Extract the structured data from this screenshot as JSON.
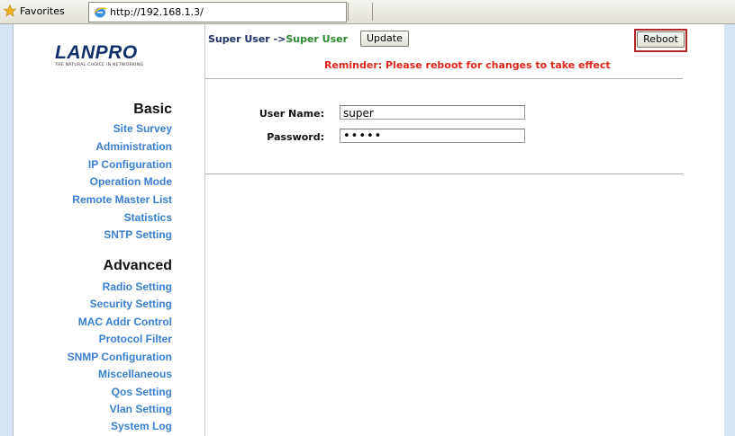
{
  "browser": {
    "favorites_label": "Favorites",
    "address": "http://192.168.1.3/"
  },
  "logo": {
    "name": "LANPRO",
    "tagline": "THE NATURAL CHOICE IN NETWORKING"
  },
  "sidebar": {
    "basic_heading": "Basic",
    "basic_items": [
      "Site Survey",
      "Administration",
      "IP Configuration",
      "Operation Mode",
      "Remote Master List",
      "Statistics",
      "SNTP Setting"
    ],
    "advanced_heading": "Advanced",
    "advanced_items": [
      "Radio Setting",
      "Security Setting",
      "MAC Addr Control",
      "Protocol Filter",
      "SNMP Configuration",
      "Miscellaneous",
      "Qos Setting",
      "Vlan Setting",
      "System Log"
    ]
  },
  "header": {
    "crumb_prefix": "Super User ->",
    "crumb_current": "Super User",
    "update_label": "Update",
    "reboot_label": "Reboot",
    "reminder": "Reminder: Please reboot for changes to take effect"
  },
  "form": {
    "username_label": "User Name:",
    "username_value": "super",
    "password_label": "Password:",
    "password_value": "•••••"
  },
  "colors": {
    "link": "#3a7fd0",
    "reminder": "#e0251b",
    "crumb_current": "#2b8a2b",
    "highlight_border": "#b22626"
  }
}
